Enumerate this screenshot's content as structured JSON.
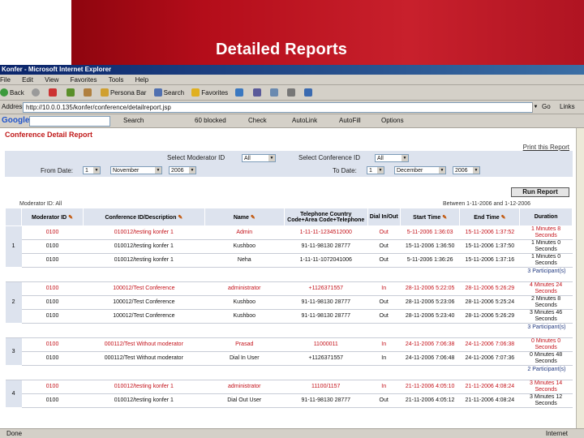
{
  "slide": {
    "title": "Detailed Reports"
  },
  "window": {
    "title": "Konfer - Microsoft Internet Explorer",
    "menu": [
      "File",
      "Edit",
      "View",
      "Favorites",
      "Tools",
      "Help"
    ],
    "toolbar": {
      "back": "Back",
      "search": "Search",
      "favorites": "Favorites",
      "persona": "Persona Bar"
    },
    "address": {
      "label": "Address",
      "value": "http://10.0.0.135/konfer/conference/detailreport.jsp",
      "go": "Go",
      "links": "Links"
    },
    "google": {
      "logo": "Google",
      "search": "Search",
      "blocked": "60 blocked",
      "check": "Check",
      "autolink": "AutoLink",
      "autofill": "AutoFill",
      "options": "Options"
    },
    "status": {
      "left": "Done",
      "right": "Internet"
    }
  },
  "report": {
    "title": "Conference Detail Report",
    "print": "Print this Report",
    "filters": {
      "moderator_label": "Select Moderator ID",
      "moderator_value": "All",
      "conference_label": "Select Conference ID",
      "conference_value": "All",
      "from_label": "From Date:",
      "from_day": "1",
      "from_month": "November",
      "from_year": "2006",
      "to_label": "To Date:",
      "to_day": "1",
      "to_month": "December",
      "to_year": "2006"
    },
    "run_button": "Run Report",
    "moderator_note": "Moderator ID: All",
    "between_note": "Between 1-11-2006 and 1-12-2006",
    "columns": [
      "Moderator ID",
      "Conference ID/Description",
      "Name",
      "Telephone Country Code+Area Code+Telephone",
      "Dial In/Out",
      "Start Time",
      "End Time",
      "Duration"
    ],
    "groups": [
      {
        "index": "1",
        "rows": [
          {
            "red": true,
            "mod": "0100",
            "conf": "010012/testing konfer 1",
            "name": "Admin",
            "tel": "1-11-11-1234512000",
            "dial": "Out",
            "start": "5-11-2006 1:36:03",
            "end": "15-11-2006 1:37:52",
            "dur": "1 Minutes 8 Seconds"
          },
          {
            "red": false,
            "mod": "0100",
            "conf": "010012/testing konfer 1",
            "name": "Kushboo",
            "tel": "91-11-98130 28777",
            "dial": "Out",
            "start": "15-11-2006 1:36:50",
            "end": "15-11-2006 1:37:50",
            "dur": "1 Minutes 0 Seconds"
          },
          {
            "red": false,
            "mod": "0100",
            "conf": "010012/testing konfer 1",
            "name": "Neha",
            "tel": "1-11-11-1072041006",
            "dial": "Out",
            "start": "5-11-2006 1:36:26",
            "end": "15-11-2006 1:37:16",
            "dur": "1 Minutes 0 Seconds"
          }
        ],
        "summary": "3 Participant(s)"
      },
      {
        "index": "2",
        "rows": [
          {
            "red": true,
            "mod": "0100",
            "conf": "100012/Test Conference",
            "name": "administrator",
            "tel": "+1126371557",
            "dial": "In",
            "start": "28-11-2006 5:22:05",
            "end": "28-11-2006 5:26:29",
            "dur": "4 Minutes 24 Seconds"
          },
          {
            "red": false,
            "mod": "0100",
            "conf": "100012/Test Conference",
            "name": "Kushboo",
            "tel": "91-11-98130 28777",
            "dial": "Out",
            "start": "28-11-2006 5:23:06",
            "end": "28-11-2006 5:25:24",
            "dur": "2 Minutes 8 Seconds"
          },
          {
            "red": false,
            "mod": "0100",
            "conf": "100012/Test Conference",
            "name": "Kushboo",
            "tel": "91-11-98130 28777",
            "dial": "Out",
            "start": "28-11-2006 5:23:40",
            "end": "28-11-2006 5:26:29",
            "dur": "3 Minutes 46 Seconds"
          }
        ],
        "summary": "3 Participant(s)"
      },
      {
        "index": "3",
        "rows": [
          {
            "red": true,
            "mod": "0100",
            "conf": "000112/Test Without moderator",
            "name": "Prasad",
            "tel": "11000011",
            "dial": "In",
            "start": "24-11-2006 7:06:38",
            "end": "24-11-2006 7:06:38",
            "dur": "0 Minutes 0 Seconds"
          },
          {
            "red": false,
            "mod": "0100",
            "conf": "000112/Test Without moderator",
            "name": "Dial In User",
            "tel": "+1126371557",
            "dial": "In",
            "start": "24-11-2006 7:06:48",
            "end": "24-11-2006 7:07:36",
            "dur": "0 Minutes 48 Seconds"
          }
        ],
        "summary": "2 Participant(s)"
      },
      {
        "index": "4",
        "rows": [
          {
            "red": true,
            "mod": "0100",
            "conf": "010012/testing konfer 1",
            "name": "administrator",
            "tel": "11100/1157",
            "dial": "In",
            "start": "21-11-2006 4:05:10",
            "end": "21-11-2006 4:08:24",
            "dur": "3 Minutes 14 Seconds"
          },
          {
            "red": false,
            "mod": "0100",
            "conf": "010012/testing konfer 1",
            "name": "Dial Out User",
            "tel": "91-11-98130 28777",
            "dial": "Out",
            "start": "21-11-2006 4:05:12",
            "end": "21-11-2006 4:08:24",
            "dur": "3 Minutes 12 Seconds"
          }
        ],
        "summary": ""
      }
    ]
  }
}
